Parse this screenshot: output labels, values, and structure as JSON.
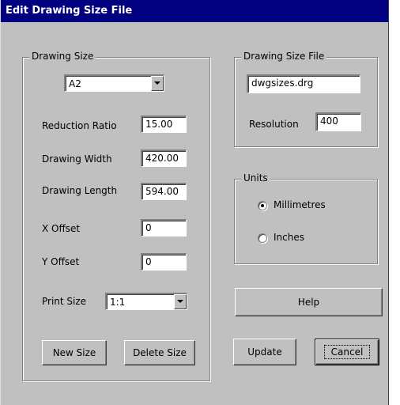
{
  "window": {
    "title": "Edit Drawing Size File"
  },
  "drawing_size": {
    "legend": "Drawing Size",
    "size_select": {
      "value": "A2"
    },
    "reduction_ratio": {
      "label": "Reduction Ratio",
      "value": "15.00"
    },
    "drawing_width": {
      "label": "Drawing Width",
      "value": "420.00"
    },
    "drawing_length": {
      "label": "Drawing Length",
      "value": "594.00"
    },
    "x_offset": {
      "label": "X Offset",
      "value": "0"
    },
    "y_offset": {
      "label": "Y Offset",
      "value": "0"
    },
    "print_size": {
      "label": "Print Size",
      "value": "1:1"
    },
    "new_size_label": "New Size",
    "delete_size_label": "Delete Size"
  },
  "drawing_size_file": {
    "legend": "Drawing Size File",
    "file_name": "dwgsizes.drg",
    "resolution": {
      "label": "Resolution",
      "value": "400"
    }
  },
  "units": {
    "legend": "Units",
    "options": [
      {
        "label": "Millimetres",
        "selected": true
      },
      {
        "label": "Inches",
        "selected": false
      }
    ]
  },
  "buttons": {
    "help": "Help",
    "update": "Update",
    "cancel": "Cancel"
  }
}
